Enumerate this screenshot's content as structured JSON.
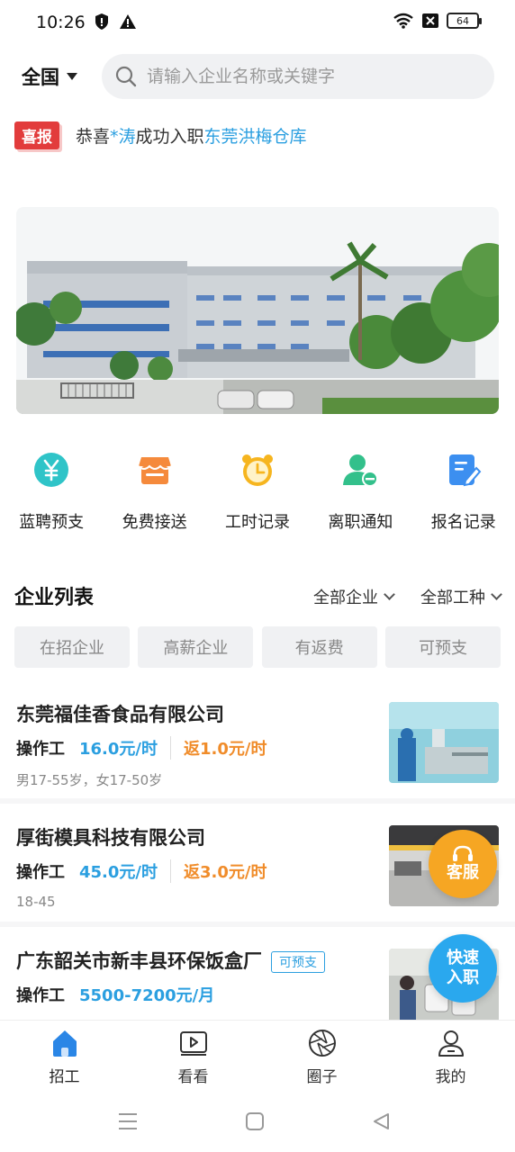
{
  "status": {
    "time": "10:26",
    "battery": "64"
  },
  "header": {
    "region": "全国",
    "search_placeholder": "请输入企业名称或关键字"
  },
  "ticker": {
    "badge": "喜报",
    "prefix": "恭喜",
    "name": "*涛",
    "middle": "成功入职",
    "company": "东莞洪梅仓库"
  },
  "functions": [
    {
      "label": "蓝聘预支",
      "icon": "yen-icon",
      "color": "#2fc4c8"
    },
    {
      "label": "免费接送",
      "icon": "shop-icon",
      "color": "#f58a3c"
    },
    {
      "label": "工时记录",
      "icon": "alarm-clock-icon",
      "color": "#f6b51f"
    },
    {
      "label": "离职通知",
      "icon": "user-remove-icon",
      "color": "#33c08b"
    },
    {
      "label": "报名记录",
      "icon": "edit-doc-icon",
      "color": "#3c8ff0"
    }
  ],
  "section": {
    "title": "企业列表",
    "filter_company": "全部企业",
    "filter_job": "全部工种"
  },
  "tags": [
    "在招企业",
    "高薪企业",
    "有返费",
    "可预支"
  ],
  "companies": [
    {
      "name": "东莞福佳香食品有限公司",
      "tag": "",
      "job": "操作工",
      "pay": "16.0元/时",
      "rebate": "返1.0元/时",
      "req": "男17-55岁，女17-50岁"
    },
    {
      "name": "厚街模具科技有限公司",
      "tag": "",
      "job": "操作工",
      "pay": "45.0元/时",
      "rebate": "返3.0元/时",
      "req": "18-45"
    },
    {
      "name": "广东韶关市新丰县环保饭盒厂",
      "tag": "可预支",
      "job": "操作工",
      "pay": "5500-7200元/月",
      "rebate": "",
      "req": ""
    }
  ],
  "floating": {
    "service": "客服",
    "quick_line1": "快速",
    "quick_line2": "入职"
  },
  "tabs": [
    {
      "label": "招工",
      "icon": "home-icon",
      "active": true
    },
    {
      "label": "看看",
      "icon": "video-icon",
      "active": false
    },
    {
      "label": "圈子",
      "icon": "aperture-icon",
      "active": false
    },
    {
      "label": "我的",
      "icon": "user-icon",
      "active": false
    }
  ],
  "colors": {
    "accent": "#2b9fe0",
    "rebate": "#f08c2a",
    "badge": "#e23c3c"
  }
}
